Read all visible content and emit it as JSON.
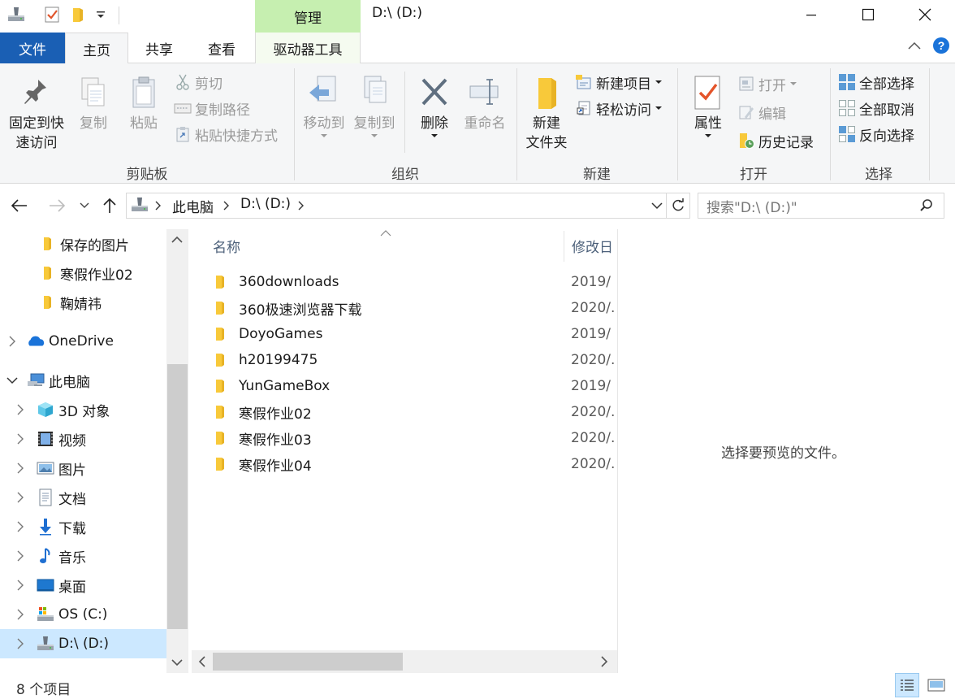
{
  "window": {
    "title": "D:\\ (D:)",
    "contextual_tab": "管理"
  },
  "ribbon_tabs": {
    "file": "文件",
    "home": "主页",
    "share": "共享",
    "view": "查看",
    "drive_tools": "驱动器工具"
  },
  "clipboard": {
    "pin_line1": "固定到快",
    "pin_line2": "速访问",
    "copy": "复制",
    "paste": "粘贴",
    "cut": "剪切",
    "copy_path": "复制路径",
    "paste_shortcut": "粘贴快捷方式",
    "group_label": "剪贴板"
  },
  "organize": {
    "move_to": "移动到",
    "copy_to": "复制到",
    "delete": "删除",
    "rename": "重命名",
    "group_label": "组织"
  },
  "new": {
    "new_folder_line1": "新建",
    "new_folder_line2": "文件夹",
    "new_item": "新建项目",
    "easy_access": "轻松访问",
    "group_label": "新建"
  },
  "open": {
    "properties": "属性",
    "open": "打开",
    "edit": "编辑",
    "history": "历史记录",
    "group_label": "打开"
  },
  "select": {
    "select_all": "全部选择",
    "select_none": "全部取消",
    "invert": "反向选择",
    "group_label": "选择"
  },
  "address": {
    "crumbs": [
      "此电脑",
      "D:\\ (D:)"
    ],
    "search_placeholder": "搜索\"D:\\ (D:)\""
  },
  "nav": {
    "items": [
      {
        "label": "保存的图片",
        "icon": "folder-icon"
      },
      {
        "label": "寒假作业02",
        "icon": "folder-icon"
      },
      {
        "label": "鞠婧祎",
        "icon": "folder-icon"
      },
      {
        "label": "OneDrive",
        "icon": "onedrive-icon"
      },
      {
        "label": "此电脑",
        "icon": "this-pc-icon"
      },
      {
        "label": "3D 对象",
        "icon": "3d-objects-icon"
      },
      {
        "label": "视频",
        "icon": "video-icon"
      },
      {
        "label": "图片",
        "icon": "pictures-icon"
      },
      {
        "label": "文档",
        "icon": "documents-icon"
      },
      {
        "label": "下载",
        "icon": "downloads-icon"
      },
      {
        "label": "音乐",
        "icon": "music-icon"
      },
      {
        "label": "桌面",
        "icon": "desktop-icon"
      },
      {
        "label": "OS (C:)",
        "icon": "drive-c-icon"
      },
      {
        "label": "D:\\ (D:)",
        "icon": "drive-d-icon"
      }
    ]
  },
  "files": {
    "col_name": "名称",
    "col_modified": "修改日",
    "rows": [
      {
        "name": "360downloads",
        "date": "2019/"
      },
      {
        "name": "360极速浏览器下载",
        "date": "2020/."
      },
      {
        "name": "DoyoGames",
        "date": "2019/"
      },
      {
        "name": "h20199475",
        "date": "2020/."
      },
      {
        "name": "YunGameBox",
        "date": "2019/"
      },
      {
        "name": "寒假作业02",
        "date": "2020/."
      },
      {
        "name": "寒假作业03",
        "date": "2020/."
      },
      {
        "name": "寒假作业04",
        "date": "2020/."
      }
    ]
  },
  "preview": {
    "message": "选择要预览的文件。"
  },
  "status": {
    "count": "8 个项目"
  },
  "colors": {
    "file_tab": "#1a5fb4",
    "manage_tab": "#c6efb0",
    "folder": "#f8d24a",
    "selected_nav": "#cce8ff"
  }
}
